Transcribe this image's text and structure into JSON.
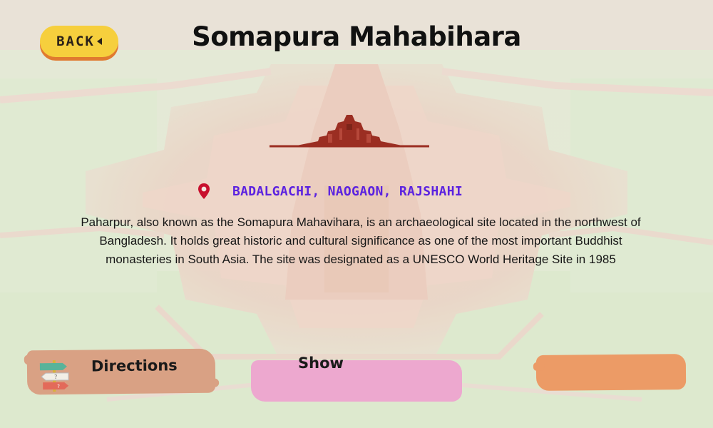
{
  "header": {
    "back_label": "BACK",
    "title": "Somapura Mahabihara"
  },
  "location": {
    "icon": "map-pin-icon",
    "text": "BADALGACHI, NAOGAON, RAJSHAHI"
  },
  "description": "Paharpur, also known as the Somapura Mahavihara, is an archaeological site located in the northwest of Bangladesh. It holds great historic and cultural significance as one of the most important Buddhist monasteries in South Asia. The site was designated as a UNESCO World Heritage Site in 1985",
  "actions": {
    "directions_label": "Directions",
    "directions_icon": "signpost-icon",
    "show_label": "Show"
  },
  "colors": {
    "back_button": "#f6cf3d",
    "back_shadow": "#e07a2f",
    "location_text": "#5b22e0",
    "pin": "#c8102e",
    "temple": "#9b2e22",
    "directions_button": "#d9a184",
    "show_button": "#eda8cf",
    "orange_button": "#ec9b66"
  }
}
